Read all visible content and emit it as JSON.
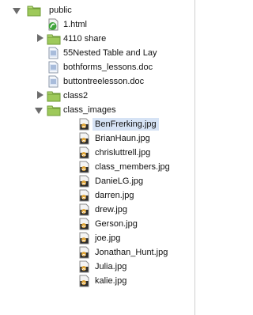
{
  "tree": {
    "root": {
      "label": "public",
      "icon": "folder-icon"
    },
    "public_children": [
      {
        "label": "1.html",
        "icon": "html-file-icon"
      },
      {
        "label": "4110 share",
        "icon": "folder-icon"
      },
      {
        "label": "55Nested Table and Lay",
        "icon": "document-file-icon"
      },
      {
        "label": "bothforms_lessons.doc",
        "icon": "document-file-icon"
      },
      {
        "label": "buttontreelesson.doc",
        "icon": "document-file-icon"
      },
      {
        "label": "class2",
        "icon": "folder-icon"
      },
      {
        "label": "class_images",
        "icon": "folder-icon"
      }
    ],
    "class_images_children": [
      {
        "label": "BenFrerking.jpg",
        "icon": "image-file-icon",
        "selected": true
      },
      {
        "label": "BrianHaun.jpg",
        "icon": "image-file-icon"
      },
      {
        "label": "chrisluttrell.jpg",
        "icon": "image-file-icon"
      },
      {
        "label": "class_members.jpg",
        "icon": "image-file-icon"
      },
      {
        "label": "DanieLG.jpg",
        "icon": "image-file-icon"
      },
      {
        "label": "darren.jpg",
        "icon": "image-file-icon"
      },
      {
        "label": "drew.jpg",
        "icon": "image-file-icon"
      },
      {
        "label": "Gerson.jpg",
        "icon": "image-file-icon"
      },
      {
        "label": "joe.jpg",
        "icon": "image-file-icon"
      },
      {
        "label": "Jonathan_Hunt.jpg",
        "icon": "image-file-icon"
      },
      {
        "label": "Julia.jpg",
        "icon": "image-file-icon"
      },
      {
        "label": "kalie.jpg",
        "icon": "image-file-icon"
      }
    ]
  },
  "colors": {
    "selection": "#d6e3f5",
    "folder": "#9ec95a",
    "disclosure": "#6c6c6c",
    "image_icon": "#d9a23a"
  }
}
